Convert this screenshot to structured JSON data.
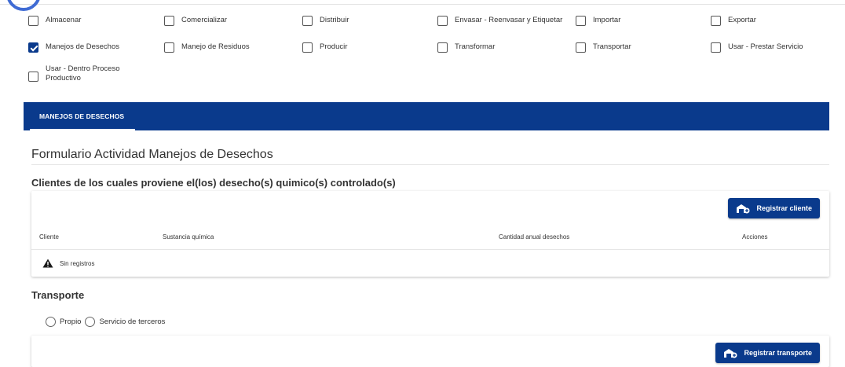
{
  "activities": [
    {
      "label": "Almacenar",
      "checked": false
    },
    {
      "label": "Comercializar",
      "checked": false
    },
    {
      "label": "Distribuir",
      "checked": false
    },
    {
      "label": "Envasar - Reenvasar y Etiquetar",
      "checked": false
    },
    {
      "label": "Importar",
      "checked": false
    },
    {
      "label": "Exportar",
      "checked": false
    },
    {
      "label": "Manejos de Desechos",
      "checked": true
    },
    {
      "label": "Manejo de Residuos",
      "checked": false
    },
    {
      "label": "Producir",
      "checked": false
    },
    {
      "label": "Transformar",
      "checked": false
    },
    {
      "label": "Transportar",
      "checked": false
    },
    {
      "label": "Usar - Prestar Servicio",
      "checked": false
    },
    {
      "label": "Usar - Dentro Proceso Productivo",
      "checked": false
    }
  ],
  "tabs": {
    "active_label": "MANEJOS DE DESECHOS"
  },
  "form": {
    "title": "Formulario Actividad Manejos de Desechos"
  },
  "clients": {
    "section_title": "Clientes de los cuales proviene el(los) desecho(s) quimico(s) controlado(s)",
    "register_button": "Registrar cliente",
    "columns": [
      "Cliente",
      "Sustancia química",
      "Cantidad anual desechos",
      "Acciones"
    ],
    "empty_text": "Sin registros"
  },
  "transport": {
    "section_title": "Transporte",
    "options": [
      "Propio",
      "Servicio de terceros"
    ],
    "register_button": "Registrar transporte"
  },
  "colors": {
    "primary": "#0a3a8c"
  }
}
